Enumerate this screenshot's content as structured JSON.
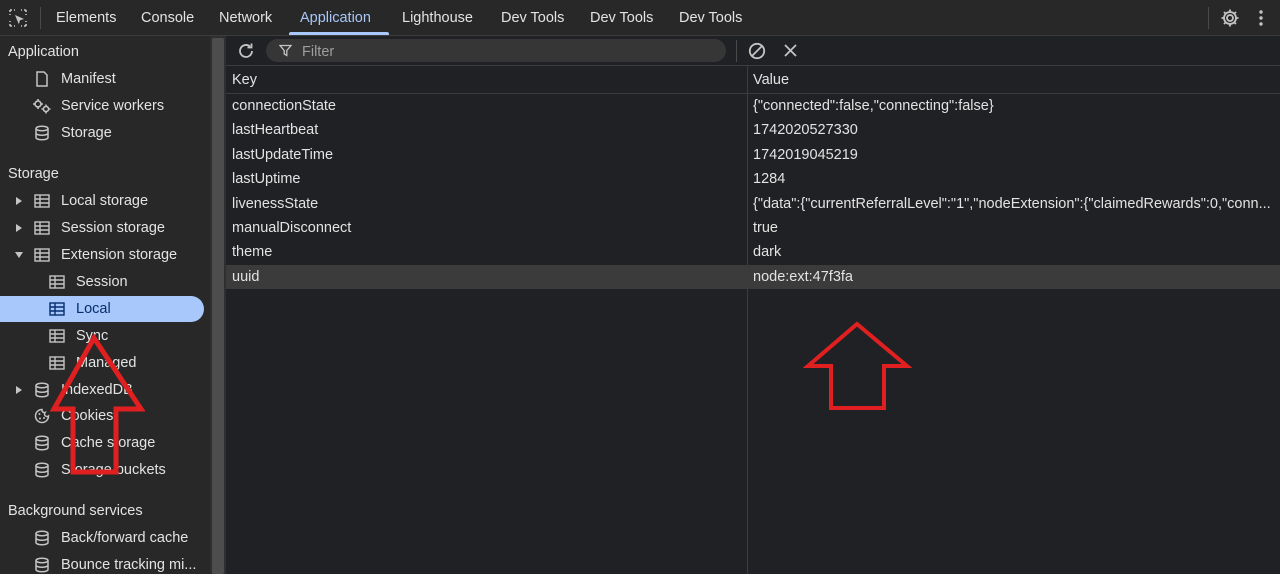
{
  "tabs": [
    {
      "label": "Elements"
    },
    {
      "label": "Console"
    },
    {
      "label": "Network"
    },
    {
      "label": "Application",
      "active": true
    },
    {
      "label": "Lighthouse"
    },
    {
      "label": "Dev Tools"
    },
    {
      "label": "Dev Tools"
    },
    {
      "label": "Dev Tools"
    }
  ],
  "sidebar": {
    "application_header": "Application",
    "application_items": [
      {
        "label": "Manifest",
        "icon": "document-icon"
      },
      {
        "label": "Service workers",
        "icon": "gears-icon"
      },
      {
        "label": "Storage",
        "icon": "database-icon"
      }
    ],
    "storage_header": "Storage",
    "storage_items": [
      {
        "label": "Local storage",
        "icon": "table-icon",
        "expander": "collapsed"
      },
      {
        "label": "Session storage",
        "icon": "table-icon",
        "expander": "collapsed"
      },
      {
        "label": "Extension storage",
        "icon": "table-icon",
        "expander": "expanded"
      },
      {
        "label": "Session",
        "icon": "table-icon"
      },
      {
        "label": "Local",
        "icon": "table-icon",
        "selected": true
      },
      {
        "label": "Sync",
        "icon": "table-icon"
      },
      {
        "label": "Managed",
        "icon": "table-icon"
      },
      {
        "label": "IndexedDB",
        "icon": "database-icon"
      },
      {
        "label": "Cookies",
        "icon": "cookie-icon"
      },
      {
        "label": "Cache storage",
        "icon": "database-icon"
      },
      {
        "label": "Storage buckets",
        "icon": "database-icon"
      }
    ],
    "background_header": "Background services",
    "background_items": [
      {
        "label": "Back/forward cache",
        "icon": "database-icon"
      },
      {
        "label": "Bounce tracking mi...",
        "icon": "database-icon"
      }
    ]
  },
  "toolbar": {
    "filter_placeholder": "Filter"
  },
  "table": {
    "key_header": "Key",
    "value_header": "Value",
    "rows": [
      {
        "key": "connectionState",
        "value": "{\"connected\":false,\"connecting\":false}"
      },
      {
        "key": "lastHeartbeat",
        "value": "1742020527330"
      },
      {
        "key": "lastUpdateTime",
        "value": "1742019045219"
      },
      {
        "key": "lastUptime",
        "value": "1284"
      },
      {
        "key": "livenessState",
        "value": "{\"data\":{\"currentReferralLevel\":\"1\",\"nodeExtension\":{\"claimedRewards\":0,\"conn..."
      },
      {
        "key": "manualDisconnect",
        "value": "true"
      },
      {
        "key": "theme",
        "value": "dark"
      },
      {
        "key": "uuid",
        "value": "node:ext:47f3fa",
        "selected": true
      }
    ]
  },
  "colors": {
    "background": "#202124",
    "sidebar": "#282828",
    "accent": "#a8c7fa",
    "annotation_arrow": "#e02020"
  }
}
